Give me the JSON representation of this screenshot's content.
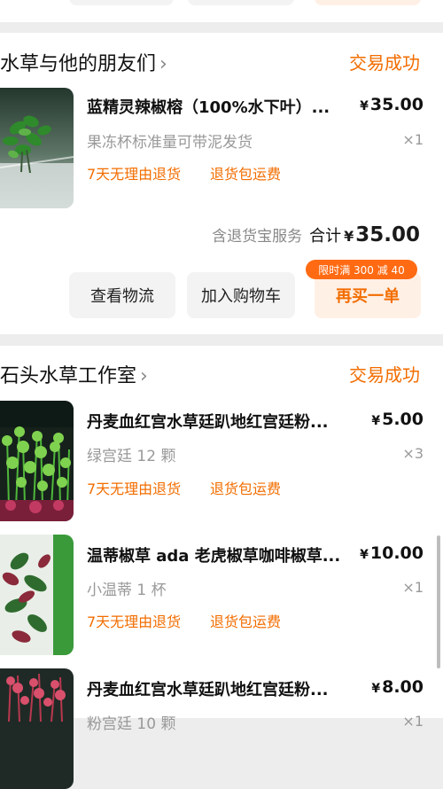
{
  "orders": [
    {
      "shop": "水草与他的朋友们",
      "status": "交易成功",
      "items": [
        {
          "title": "蓝精灵辣椒榕（100%水下叶）...",
          "price": "35.00",
          "sku": "果冻杯标准量可带泥发货",
          "qty": "×1",
          "tags": [
            "7天无理由退货",
            "退货包运费"
          ]
        }
      ],
      "service": "含退货宝服务",
      "total_label": "合计",
      "total": "35.00",
      "buttons": {
        "logistics": "查看物流",
        "add_cart": "加入购物车",
        "rebuy": "再买一单",
        "promo": "限时满 300 减 40"
      }
    },
    {
      "shop": "石头水草工作室",
      "status": "交易成功",
      "items": [
        {
          "title": "丹麦血红宫水草廷趴地红宫廷粉...",
          "price": "5.00",
          "sku": "绿宫廷 12 颗",
          "qty": "×3",
          "tags": [
            "7天无理由退货",
            "退货包运费"
          ]
        },
        {
          "title": "温蒂椒草 ada 老虎椒草咖啡椒草...",
          "price": "10.00",
          "sku": "小温蒂 1 杯",
          "qty": "×1",
          "tags": [
            "7天无理由退货",
            "退货包运费"
          ]
        },
        {
          "title": "丹麦血红宫水草廷趴地红宫廷粉...",
          "price": "8.00",
          "sku": "粉宫廷 10 颗",
          "qty": "×1"
        }
      ]
    }
  ],
  "currency": "¥",
  "colors": {
    "accent": "#f26d00",
    "promo_bg": "#ff6a13",
    "buy_bg": "#fff0e6"
  }
}
